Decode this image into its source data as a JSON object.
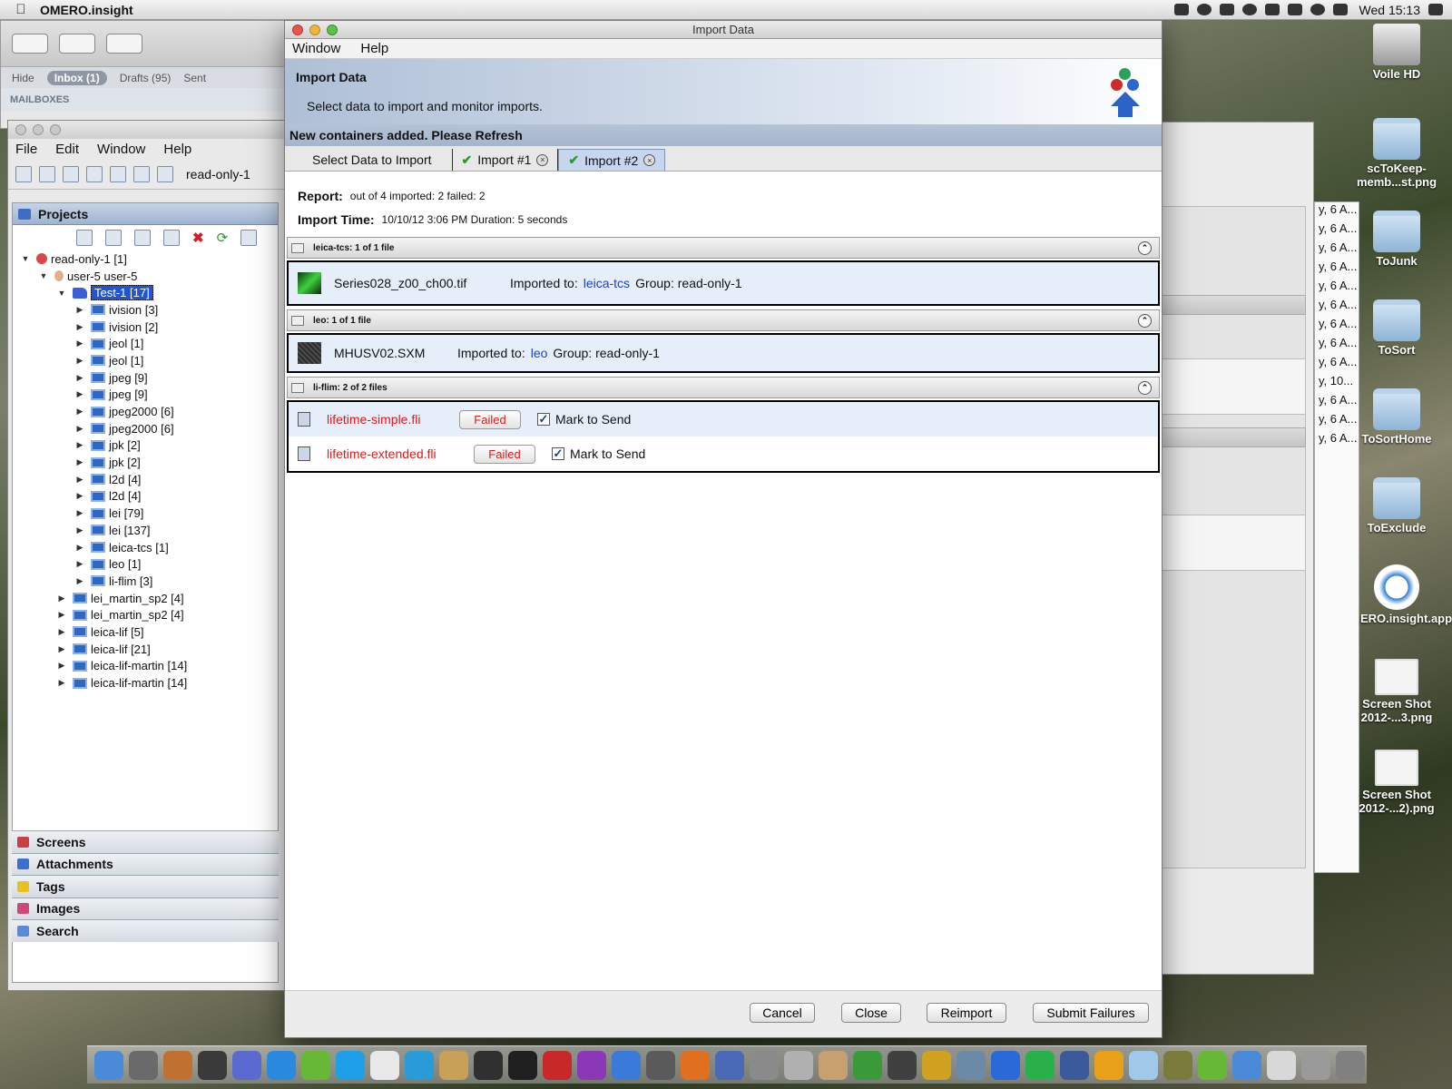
{
  "menubar": {
    "app_name": "OMERO.insight",
    "clock": "Wed 15:13"
  },
  "desktop": {
    "icons": [
      {
        "label": "Voile HD",
        "type": "hd"
      },
      {
        "label": "scToKeep-memb...st.png",
        "type": "folder"
      },
      {
        "label": "ToJunk",
        "type": "folder"
      },
      {
        "label": "ToSort",
        "type": "folder"
      },
      {
        "label": "ToSortHome",
        "type": "folder"
      },
      {
        "label": "ToExclude",
        "type": "folder"
      },
      {
        "label": "OMERO.insight.app",
        "type": "app"
      },
      {
        "label": "Screen Shot 2012-...3.png",
        "type": "shot"
      },
      {
        "label": "Screen Shot 2012-...2).png",
        "type": "shot"
      }
    ]
  },
  "mail": {
    "hide": "Hide",
    "inbox": "Inbox (1)",
    "drafts": "Drafts (95)",
    "sent": "Sent",
    "mailboxes": "MAILBOXES"
  },
  "right_list": [
    "y, 6 A...",
    "y, 6 A...",
    "y, 6 A...",
    "y, 6 A...",
    "y, 6 A...",
    "y, 6 A...",
    "y, 6 A...",
    "y, 6 A...",
    "y, 6 A...",
    "y, 10...",
    "y, 6 A...",
    "y, 6 A...",
    "y, 6 A..."
  ],
  "omero": {
    "menu": [
      "File",
      "Edit",
      "Window",
      "Help"
    ],
    "toolbar_user": "read-only-1",
    "projects_label": "Projects",
    "tree": [
      {
        "label": "read-only-1 [1]",
        "depth": 0,
        "icon": "grp",
        "arrow": "down"
      },
      {
        "label": "user-5 user-5",
        "depth": 1,
        "icon": "usr",
        "arrow": "down"
      },
      {
        "label": "Test-1 [17]",
        "depth": 2,
        "icon": "proj",
        "arrow": "down",
        "selected": true
      },
      {
        "label": "ivision [3]",
        "depth": 3,
        "icon": "ds",
        "arrow": "right"
      },
      {
        "label": "ivision [2]",
        "depth": 3,
        "icon": "ds",
        "arrow": "right"
      },
      {
        "label": "jeol [1]",
        "depth": 3,
        "icon": "ds",
        "arrow": "right"
      },
      {
        "label": "jeol [1]",
        "depth": 3,
        "icon": "ds",
        "arrow": "right"
      },
      {
        "label": "jpeg [9]",
        "depth": 3,
        "icon": "ds",
        "arrow": "right"
      },
      {
        "label": "jpeg [9]",
        "depth": 3,
        "icon": "ds",
        "arrow": "right"
      },
      {
        "label": "jpeg2000 [6]",
        "depth": 3,
        "icon": "ds",
        "arrow": "right"
      },
      {
        "label": "jpeg2000 [6]",
        "depth": 3,
        "icon": "ds",
        "arrow": "right"
      },
      {
        "label": "jpk [2]",
        "depth": 3,
        "icon": "ds",
        "arrow": "right"
      },
      {
        "label": "jpk [2]",
        "depth": 3,
        "icon": "ds",
        "arrow": "right"
      },
      {
        "label": "l2d [4]",
        "depth": 3,
        "icon": "ds",
        "arrow": "right"
      },
      {
        "label": "l2d [4]",
        "depth": 3,
        "icon": "ds",
        "arrow": "right"
      },
      {
        "label": "lei [79]",
        "depth": 3,
        "icon": "ds",
        "arrow": "right"
      },
      {
        "label": "lei [137]",
        "depth": 3,
        "icon": "ds",
        "arrow": "right"
      },
      {
        "label": "leica-tcs [1]",
        "depth": 3,
        "icon": "ds",
        "arrow": "right"
      },
      {
        "label": "leo [1]",
        "depth": 3,
        "icon": "ds",
        "arrow": "right"
      },
      {
        "label": "li-flim [3]",
        "depth": 3,
        "icon": "ds",
        "arrow": "right"
      },
      {
        "label": "lei_martin_sp2 [4]",
        "depth": 2,
        "icon": "ds",
        "arrow": "right"
      },
      {
        "label": "lei_martin_sp2 [4]",
        "depth": 2,
        "icon": "ds",
        "arrow": "right"
      },
      {
        "label": "leica-lif [5]",
        "depth": 2,
        "icon": "ds",
        "arrow": "right"
      },
      {
        "label": "leica-lif [21]",
        "depth": 2,
        "icon": "ds",
        "arrow": "right"
      },
      {
        "label": "leica-lif-martin [14]",
        "depth": 2,
        "icon": "ds",
        "arrow": "right"
      },
      {
        "label": "leica-lif-martin [14]",
        "depth": 2,
        "icon": "ds",
        "arrow": "right"
      }
    ],
    "bottom_panels": [
      {
        "label": "Screens",
        "color": "#c84040"
      },
      {
        "label": "Attachments",
        "color": "#3b6fd0"
      },
      {
        "label": "Tags",
        "color": "#e8c020"
      },
      {
        "label": "Images",
        "color": "#d04878"
      },
      {
        "label": "Search",
        "color": "#5a8ad8"
      }
    ]
  },
  "dialog": {
    "window_title": "Import Data",
    "menu": [
      "Window",
      "Help"
    ],
    "banner_title": "Import Data",
    "banner_subtitle": "Select data to import and monitor imports.",
    "notice": "New containers added. Please Refresh",
    "tabs": [
      {
        "label": "Select Data to Import",
        "active": false,
        "closable": false,
        "check": false
      },
      {
        "label": "Import #1",
        "active": false,
        "closable": true,
        "check": true
      },
      {
        "label": "Import #2",
        "active": true,
        "closable": true,
        "check": true
      }
    ],
    "report_label": "Report:",
    "report_value": "out of 4 imported: 2 failed: 2",
    "time_label": "Import Time:",
    "time_value": "10/10/12 3:06 PM Duration:  5 seconds",
    "groups": [
      {
        "header": "leica-tcs: 1 of 1 file"
      },
      {
        "header": "leo: 1 of 1 file"
      },
      {
        "header": "li-flim: 2 of 2 files"
      }
    ],
    "imported_files": [
      {
        "name": "Series028_z00_ch00.tif",
        "imported_to_label": "Imported to:",
        "target": "leica-tcs",
        "group": "Group: read-only-1"
      },
      {
        "name": "MHUSV02.SXM",
        "imported_to_label": "Imported to:",
        "target": "leo",
        "group": "Group: read-only-1"
      }
    ],
    "failed_files": [
      {
        "name": "lifetime-simple.fli",
        "status": "Failed",
        "mark_label": "Mark to Send",
        "checked": true
      },
      {
        "name": "lifetime-extended.fli",
        "status": "Failed",
        "mark_label": "Mark to Send",
        "checked": true
      }
    ],
    "buttons": {
      "cancel": "Cancel",
      "close": "Close",
      "reimport": "Reimport",
      "submit": "Submit Failures"
    }
  },
  "colors": {
    "link": "#1b3fcf",
    "failed": "#e01818",
    "selection": "#1f56d6"
  }
}
